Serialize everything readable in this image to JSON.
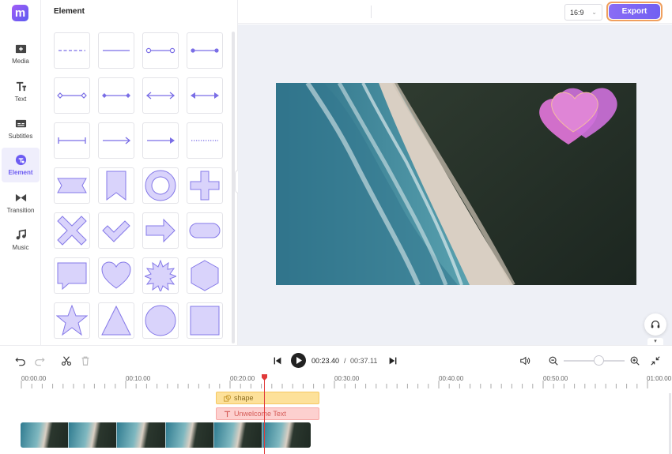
{
  "app": {
    "logo_letter": "m"
  },
  "nav": [
    {
      "label": "Media",
      "icon": "media-icon"
    },
    {
      "label": "Text",
      "icon": "text-icon"
    },
    {
      "label": "Subtitles",
      "icon": "subtitles-icon"
    },
    {
      "label": "Element",
      "icon": "element-icon",
      "active": true
    },
    {
      "label": "Transition",
      "icon": "transition-icon"
    },
    {
      "label": "Music",
      "icon": "music-icon"
    }
  ],
  "panel": {
    "title": "Element",
    "elements": [
      "dashed-line",
      "solid-line",
      "line-circle-ends",
      "line-dot-ends",
      "line-diamond-outline-ends",
      "line-diamond-ends",
      "double-arrow-open",
      "double-arrow-solid",
      "bar-line",
      "arrow-line-open",
      "arrow-line-solid",
      "dotted-line",
      "ribbon-banner",
      "bookmark",
      "ring",
      "plus",
      "cross",
      "checkmark",
      "arrow-block",
      "rounded-rectangle",
      "speech-bubble",
      "heart",
      "starburst",
      "hexagon",
      "star",
      "triangle",
      "circle",
      "square"
    ]
  },
  "topbar": {
    "aspect_ratio": "16:9",
    "export_label": "Export"
  },
  "colors": {
    "accent": "#7a66f4",
    "shape_fill": "#d9d3fb",
    "shape_stroke": "#8478e8",
    "playhead": "#e03a3a"
  },
  "player": {
    "current_time": "00:23.40",
    "separator": "/",
    "total_time": "00:37.11",
    "zoom_level": 0.58
  },
  "ruler": {
    "labels": [
      "00:00.00",
      "00:10.00",
      "00:20.00",
      "00:30.00",
      "00:40.00",
      "00:50.00",
      "01:00.00"
    ]
  },
  "tracks": {
    "shape_label": "shape",
    "text_label": "Unwelcome Text"
  }
}
